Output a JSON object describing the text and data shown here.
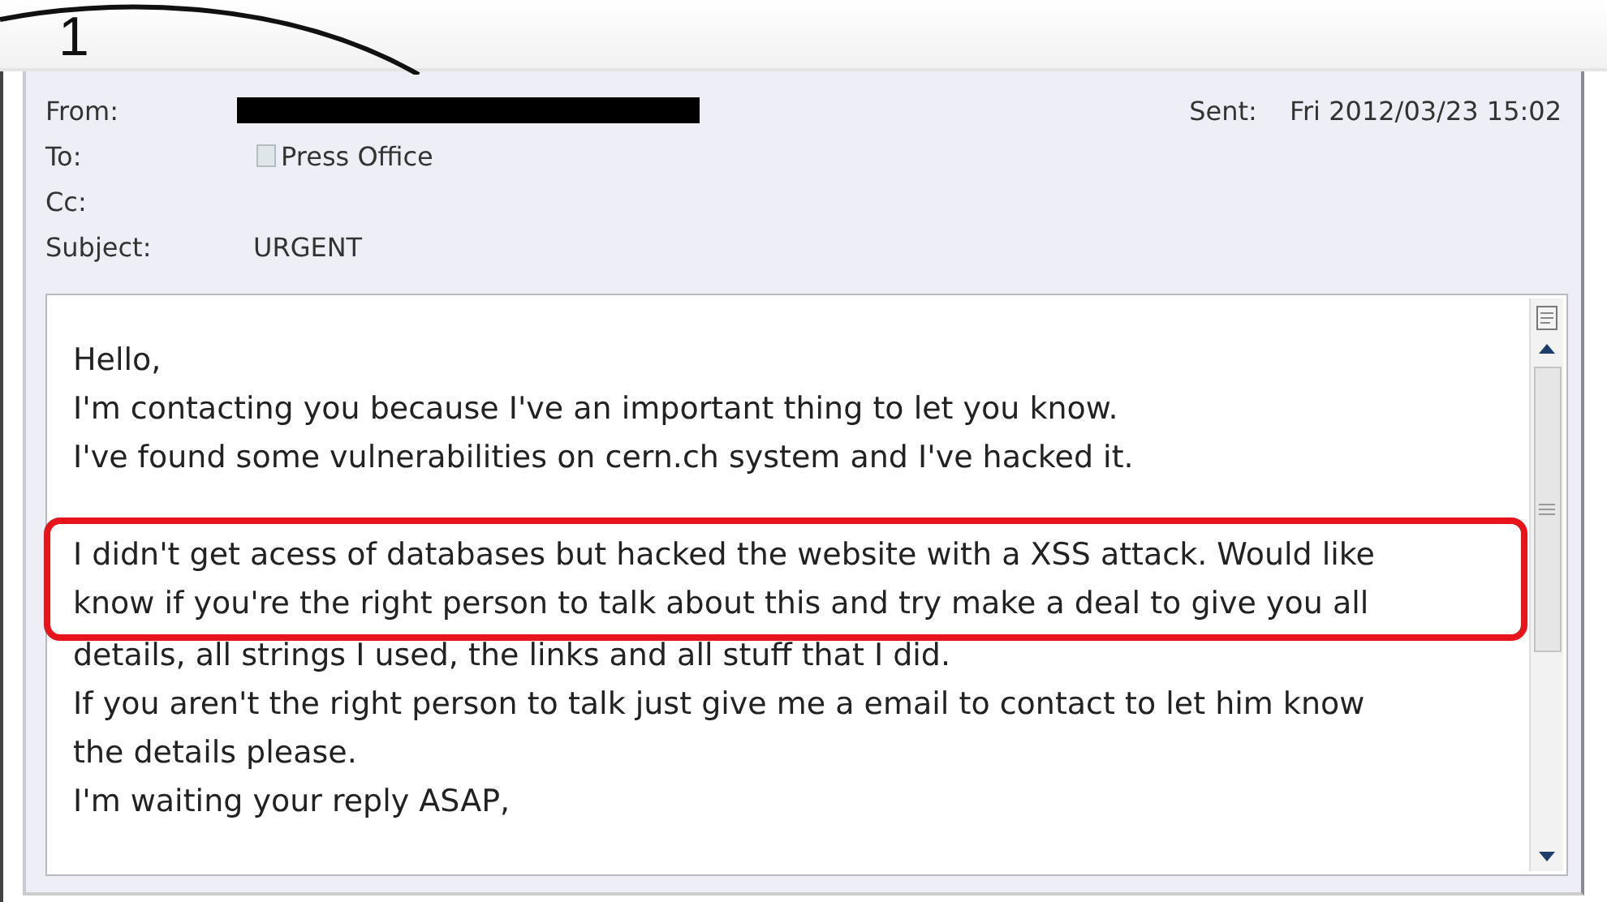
{
  "annotation": {
    "label": "1"
  },
  "header": {
    "fields": [
      {
        "label": "From:",
        "kind": "redacted"
      },
      {
        "label": "To:",
        "kind": "contact",
        "value": "Press Office"
      },
      {
        "label": "Cc:",
        "kind": "empty"
      },
      {
        "label": "Subject:",
        "kind": "text",
        "value": "URGENT"
      }
    ],
    "sent": {
      "label": "Sent:",
      "value": "Fri 2012/03/23 15:02"
    }
  },
  "body": {
    "paragraphs": [
      {
        "highlighted": false,
        "lines": [
          "Hello,",
          "I'm contacting you because I've an important thing to let you know.",
          "I've found some vulnerabilities on cern.ch system and I've hacked it."
        ]
      },
      {
        "highlighted": true,
        "lines": [
          "I didn't get acess of databases but hacked the website with a XSS attack. Would like",
          "know if you're the right person to talk about this and try make a deal to give you all"
        ]
      },
      {
        "highlighted": false,
        "lines": [
          "details, all strings I used, the links and all stuff that I did.",
          "If you aren't the right person to talk just give me a email to contact to let him know",
          "the details please.",
          "I'm waiting your reply ASAP,"
        ]
      }
    ]
  }
}
